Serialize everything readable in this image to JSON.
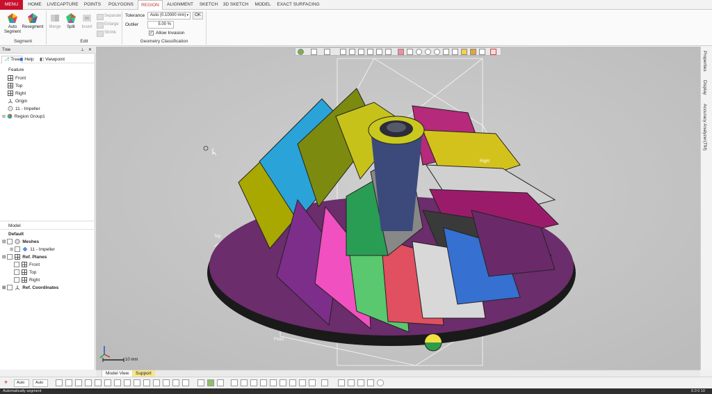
{
  "tabs": [
    "MENU",
    "HOME",
    "LIVECAPTURE",
    "POINTS",
    "POLYGONS",
    "REGION",
    "ALIGNMENT",
    "SKETCH",
    "3D SKETCH",
    "MODEL",
    "EXACT SURFACING"
  ],
  "ribbon": {
    "segment_group": {
      "label": "Segment",
      "auto_segment": "Auto\nSegment",
      "resegment": "Resegment"
    },
    "edit_group": {
      "label": "Edit",
      "merge": "Merge",
      "split": "Split",
      "insert": "Insert",
      "separate": "Separate",
      "enlarge": "Enlarge",
      "shrink": "Shrink"
    },
    "geometry_group": {
      "label": "Geometry Classification",
      "tolerance_label": "Tolerance",
      "tolerance_value": "Auto (0.10000 mm)",
      "ok": "OK",
      "outlier_label": "Outlier",
      "outlier_value": "5.00 %",
      "allow_invasion": "Allow Invasion",
      "allow_invasion_checked": true
    }
  },
  "tree_panel": {
    "title": "Tree",
    "tabs": [
      "Tree",
      "Help",
      "Viewpoint"
    ],
    "section": "Feature",
    "items": [
      {
        "label": "Front",
        "icon": "plane-icon"
      },
      {
        "label": "Top",
        "icon": "plane-icon"
      },
      {
        "label": "Right",
        "icon": "plane-icon"
      },
      {
        "label": "Origin",
        "icon": "axis-icon"
      },
      {
        "label": "11 - Impeller",
        "icon": "mesh-icon"
      },
      {
        "label": "Region Group1",
        "icon": "region-icon"
      }
    ]
  },
  "model_panel": {
    "title": "Model",
    "items": [
      {
        "label": "Default",
        "level": 0
      },
      {
        "label": "Meshes",
        "level": 1
      },
      {
        "label": "11 - Impeller",
        "level": 2
      },
      {
        "label": "Ref. Planes",
        "level": 1
      },
      {
        "label": "Front",
        "level": 2
      },
      {
        "label": "Top",
        "level": 2
      },
      {
        "label": "Right",
        "level": 2
      },
      {
        "label": "Ref. Coordinates",
        "level": 1
      }
    ]
  },
  "viewport": {
    "plane_labels": {
      "top": "Top",
      "front": "Front",
      "right": "Right"
    },
    "scale_label": "10 mm"
  },
  "right_tabs": [
    "Properties",
    "Display",
    "Accuracy Analyzer(TM)"
  ],
  "bottom_tabs": [
    "Model View",
    "Support"
  ],
  "bottom_toolbar": {
    "select1": "Auto",
    "select2": "Auto"
  },
  "status": {
    "text": "Automatically segment",
    "right": "0.0 0 10"
  }
}
